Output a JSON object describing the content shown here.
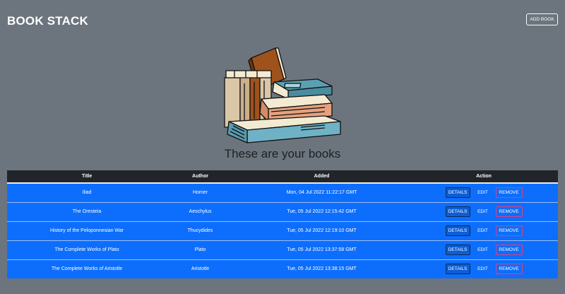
{
  "app": {
    "title": "BOOK STACK",
    "add_button": "ADD BOOK"
  },
  "hero": {
    "illustration": "stack-of-books-illustration",
    "heading": "These are your books"
  },
  "table": {
    "columns": [
      "Title",
      "Author",
      "Added",
      "Action"
    ],
    "actions": {
      "details": "DETAILS",
      "edit": "EDIT",
      "remove": "REMOVE"
    },
    "rows": [
      {
        "title": "Iliad",
        "author": "Homer",
        "added": "Mon, 04 Jul 2022 11:22:17 GMT"
      },
      {
        "title": "The Oresteia",
        "author": "Aeschylus",
        "added": "Tue, 05 Jul 2022 12:15:42 GMT"
      },
      {
        "title": "History of the Peloponnesian War",
        "author": "Thucydides",
        "added": "Tue, 05 Jul 2022 12:19:10 GMT"
      },
      {
        "title": "The Complete Works of Plato",
        "author": "Plato",
        "added": "Tue, 05 Jul 2022 13:37:58 GMT"
      },
      {
        "title": "The Complete Works of Aristotle",
        "author": "Aristotle",
        "added": "Tue, 05 Jul 2022 13:38:15 GMT"
      }
    ]
  },
  "colors": {
    "background": "#6c757d",
    "row": "#0d6efd",
    "header": "#212529",
    "remove_border": "#e0407a"
  }
}
